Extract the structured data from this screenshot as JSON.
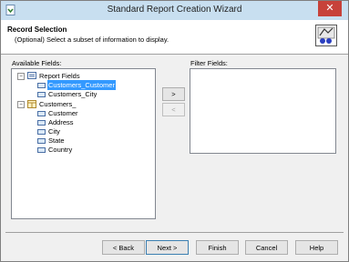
{
  "window": {
    "title": "Standard Report Creation Wizard",
    "close_glyph": "✕"
  },
  "header": {
    "title": "Record Selection",
    "subtitle": "(Optional)  Select a subset of information to display."
  },
  "available": {
    "label": "Available Fields:",
    "tree": {
      "report_fields": {
        "label": "Report Fields",
        "expander": "−",
        "children": [
          "Customers_Customer",
          "Customers_City"
        ]
      },
      "customers": {
        "label": "Customers_",
        "expander": "−",
        "children": [
          "Customer",
          "Address",
          "City",
          "State",
          "Country"
        ]
      }
    }
  },
  "filter": {
    "label": "Filter Fields:"
  },
  "move": {
    "add": ">",
    "remove": "<"
  },
  "footer": {
    "back": "< Back",
    "next": "Next >",
    "finish": "Finish",
    "cancel": "Cancel",
    "help": "Help"
  },
  "colors": {
    "selection": "#3399ff",
    "titlebar": "#c8dff0",
    "close": "#c7423a"
  }
}
